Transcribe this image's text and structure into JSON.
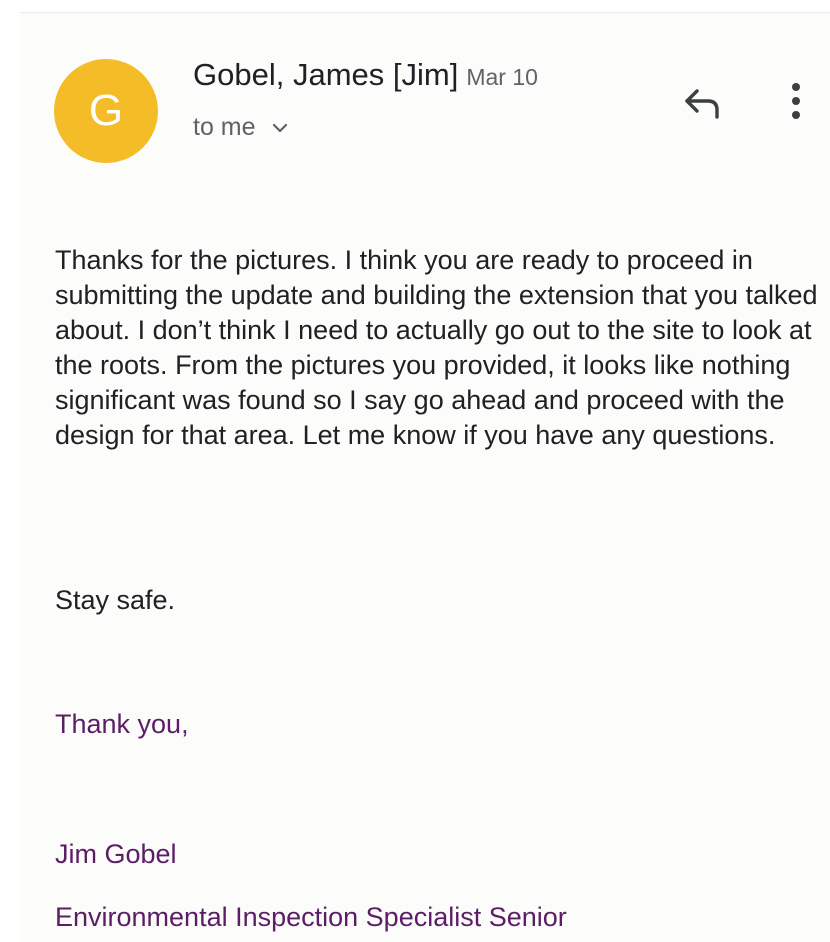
{
  "header": {
    "avatar_letter": "G",
    "avatar_color": "#f4bd28",
    "sender_name": "Gobel, James [Jim]",
    "date": "Mar 10",
    "recipient_label": "to me",
    "icons": {
      "reply": "reply-icon",
      "more": "more-vert-icon",
      "expand": "chevron-down-icon"
    }
  },
  "message": {
    "body": "Thanks for the pictures. I think you are ready to proceed in submitting the update and building the extension that you talked about. I don’t think I need to actually go out to the site to look at the roots. From the pictures you provided, it looks like nothing significant was found so I say go ahead and proceed with the design for that area. Let me know if you have any questions.",
    "sign_off": "Stay safe."
  },
  "signature": {
    "closing": "Thank you,",
    "name": "Jim Gobel",
    "title": "Environmental Inspection Specialist Senior",
    "color": "#5b1e66"
  }
}
